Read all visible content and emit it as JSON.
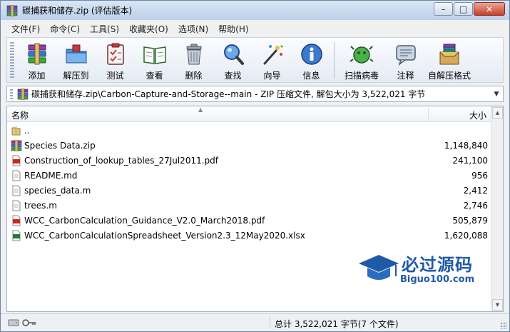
{
  "window": {
    "title": "碳捕获和储存.zip (评估版本)",
    "controls": {
      "minimize": "–",
      "maximize": "□",
      "close": "✕"
    }
  },
  "menu": [
    {
      "label": "文件(F)"
    },
    {
      "label": "命令(C)"
    },
    {
      "label": "工具(S)"
    },
    {
      "label": "收藏夹(O)"
    },
    {
      "label": "选项(N)"
    },
    {
      "label": "帮助(H)"
    }
  ],
  "toolbar": {
    "buttons": [
      {
        "label": "添加",
        "icon": "add-archive-icon"
      },
      {
        "label": "解压到",
        "icon": "extract-folder-icon"
      },
      {
        "label": "测试",
        "icon": "test-clipboard-icon"
      },
      {
        "label": "查看",
        "icon": "view-book-icon"
      },
      {
        "label": "删除",
        "icon": "trash-icon"
      },
      {
        "label": "查找",
        "icon": "magnifier-icon"
      },
      {
        "label": "向导",
        "icon": "wizard-wand-icon"
      },
      {
        "label": "信息",
        "icon": "info-icon"
      }
    ],
    "buttons_right": [
      {
        "label": "扫描病毒",
        "icon": "virus-scan-icon"
      },
      {
        "label": "注释",
        "icon": "comment-icon"
      },
      {
        "label": "自解压格式",
        "icon": "sfx-archive-icon"
      }
    ]
  },
  "address": {
    "text": "碳捕获和储存.zip\\Carbon-Capture-and-Storage--main - ZIP 压缩文件, 解包大小为 3,522,021 字节"
  },
  "list": {
    "headers": {
      "name": "名称",
      "size": "大小"
    },
    "rows": [
      {
        "name": "..",
        "size": "",
        "type": "parent-folder"
      },
      {
        "name": "Species Data.zip",
        "size": "1,148,840",
        "type": "zip"
      },
      {
        "name": "Construction_of_lookup_tables_27Jul2011.pdf",
        "size": "241,100",
        "type": "pdf"
      },
      {
        "name": "README.md",
        "size": "956",
        "type": "text"
      },
      {
        "name": "species_data.m",
        "size": "2,412",
        "type": "text"
      },
      {
        "name": "trees.m",
        "size": "2,746",
        "type": "text"
      },
      {
        "name": "WCC_CarbonCalculation_Guidance_V2.0_March2018.pdf",
        "size": "505,879",
        "type": "pdf"
      },
      {
        "name": "WCC_CarbonCalculationSpreadsheet_Version2.3_12May2020.xlsx",
        "size": "1,620,088",
        "type": "xlsx"
      }
    ]
  },
  "watermark": {
    "brand": "必过源码",
    "url": "Biguo100.com"
  },
  "status": {
    "summary": "总计 3,522,021 字节(7 个文件)"
  },
  "colors": {
    "accent": "#1f5aa8",
    "pdf": "#c8281e",
    "xlsx": "#1d7a3a"
  }
}
